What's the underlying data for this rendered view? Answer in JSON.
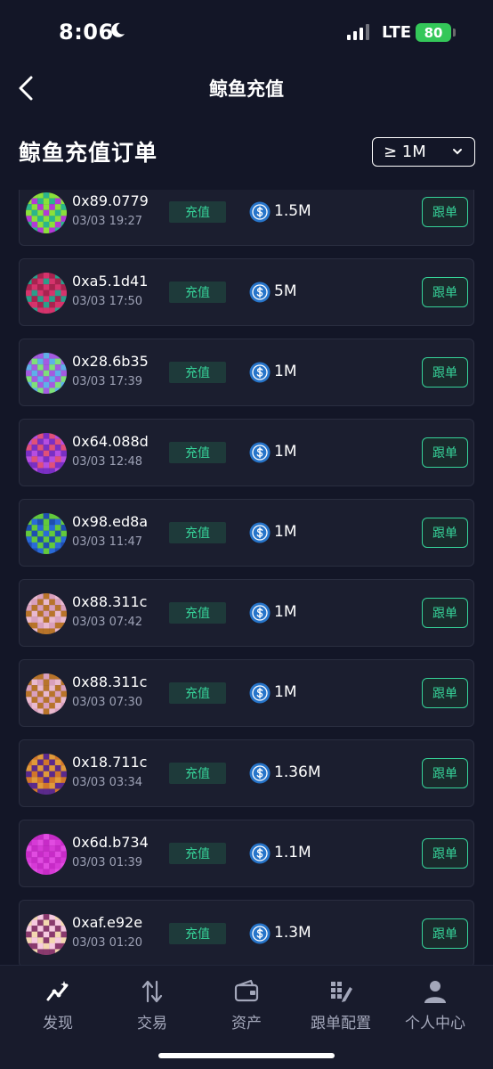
{
  "status_bar": {
    "time": "8:06",
    "network": "LTE",
    "battery": "80"
  },
  "header": {
    "title": "鲸鱼充值"
  },
  "section": {
    "title": "鲸鱼充值订单",
    "filter_value": "≥ 1M"
  },
  "orders": [
    {
      "address": "0x89.0779",
      "time": "03/03 19:27",
      "tag": "充值",
      "amount": "1.5M",
      "action": "跟单",
      "avatar_colors": [
        "#b33ad6",
        "#8be03a",
        "#2bb58c"
      ]
    },
    {
      "address": "0xa5.1d41",
      "time": "03/03 17:50",
      "tag": "充值",
      "amount": "5M",
      "action": "跟单",
      "avatar_colors": [
        "#2b9e8a",
        "#d6336c",
        "#a8234f"
      ]
    },
    {
      "address": "0x28.6b35",
      "time": "03/03 17:39",
      "tag": "充值",
      "amount": "1M",
      "action": "跟单",
      "avatar_colors": [
        "#7ee07a",
        "#a45be0",
        "#5fb0e8"
      ]
    },
    {
      "address": "0x64.088d",
      "time": "03/03 12:48",
      "tag": "充值",
      "amount": "1M",
      "action": "跟单",
      "avatar_colors": [
        "#b64de0",
        "#7a2fc4",
        "#e0507a"
      ]
    },
    {
      "address": "0x98.ed8a",
      "time": "03/03 11:47",
      "tag": "充值",
      "amount": "1M",
      "action": "跟单",
      "avatar_colors": [
        "#2a6ad8",
        "#63c93c",
        "#1f4fb0"
      ]
    },
    {
      "address": "0x88.311c",
      "time": "03/03 07:42",
      "tag": "充值",
      "amount": "1M",
      "action": "跟单",
      "avatar_colors": [
        "#e9b9cf",
        "#b8742a",
        "#d9a0bd"
      ]
    },
    {
      "address": "0x88.311c",
      "time": "03/03 07:30",
      "tag": "充值",
      "amount": "1M",
      "action": "跟单",
      "avatar_colors": [
        "#e9b9cf",
        "#b8742a",
        "#d9a0bd"
      ]
    },
    {
      "address": "0x18.711c",
      "time": "03/03 03:34",
      "tag": "充值",
      "amount": "1.36M",
      "action": "跟单",
      "avatar_colors": [
        "#d1762a",
        "#5b2a8c",
        "#e09a3a"
      ]
    },
    {
      "address": "0x6d.b734",
      "time": "03/03 01:39",
      "tag": "充值",
      "amount": "1.1M",
      "action": "跟单",
      "avatar_colors": [
        "#d63ad6",
        "#c72bc7",
        "#e14be1"
      ]
    },
    {
      "address": "0xaf.e92e",
      "time": "03/03 01:20",
      "tag": "充值",
      "amount": "1.3M",
      "action": "跟单",
      "avatar_colors": [
        "#f3d7b0",
        "#8a3a6e",
        "#f6c9e0"
      ]
    }
  ],
  "tabs": [
    {
      "label": "发现",
      "icon": "discover-icon",
      "active": true
    },
    {
      "label": "交易",
      "icon": "trade-arrows-icon",
      "active": false
    },
    {
      "label": "资产",
      "icon": "wallet-icon",
      "active": false
    },
    {
      "label": "跟单配置",
      "icon": "grid-edit-icon",
      "active": false
    },
    {
      "label": "个人中心",
      "icon": "user-icon",
      "active": false
    }
  ],
  "colors": {
    "background": "#131627",
    "card": "#1b1e2f",
    "accent_green": "#36d399",
    "usdc_blue": "#2775ca"
  }
}
